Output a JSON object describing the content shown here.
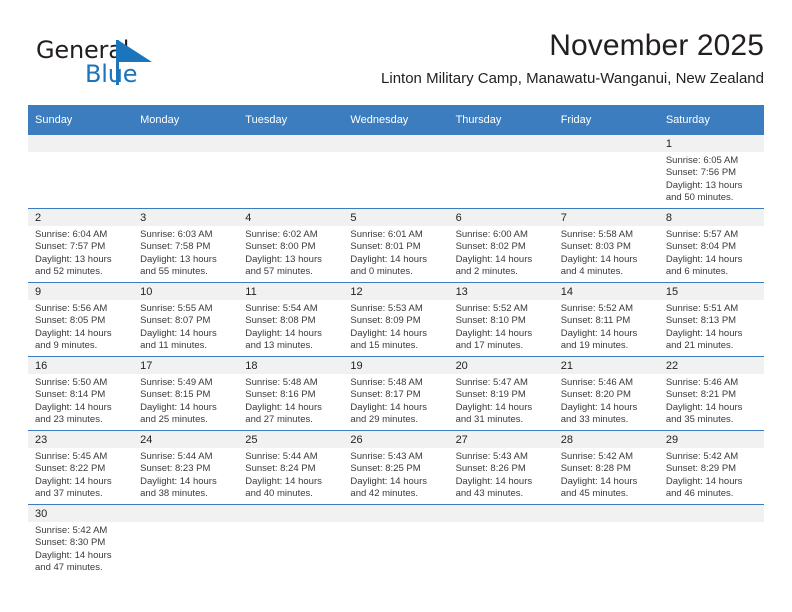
{
  "logo": {
    "word_one": "General",
    "word_two": "Blue",
    "icon": "triangle-flag-logo"
  },
  "header": {
    "month_title": "November 2025",
    "location": "Linton Military Camp, Manawatu-Wanganui, New Zealand"
  },
  "colors": {
    "header_blue": "#3c7dbf",
    "daynum_band": "#f1f1f1",
    "logo_blue": "#1b75bc",
    "text": "#231f20"
  },
  "calendar": {
    "columns": [
      "Sunday",
      "Monday",
      "Tuesday",
      "Wednesday",
      "Thursday",
      "Friday",
      "Saturday"
    ],
    "weeks": [
      [
        {
          "day": "",
          "sunrise": "",
          "sunset": "",
          "daylight_line1": "",
          "daylight_line2": ""
        },
        {
          "day": "",
          "sunrise": "",
          "sunset": "",
          "daylight_line1": "",
          "daylight_line2": ""
        },
        {
          "day": "",
          "sunrise": "",
          "sunset": "",
          "daylight_line1": "",
          "daylight_line2": ""
        },
        {
          "day": "",
          "sunrise": "",
          "sunset": "",
          "daylight_line1": "",
          "daylight_line2": ""
        },
        {
          "day": "",
          "sunrise": "",
          "sunset": "",
          "daylight_line1": "",
          "daylight_line2": ""
        },
        {
          "day": "",
          "sunrise": "",
          "sunset": "",
          "daylight_line1": "",
          "daylight_line2": ""
        },
        {
          "day": "1",
          "sunrise": "Sunrise: 6:05 AM",
          "sunset": "Sunset: 7:56 PM",
          "daylight_line1": "Daylight: 13 hours",
          "daylight_line2": "and 50 minutes."
        }
      ],
      [
        {
          "day": "2",
          "sunrise": "Sunrise: 6:04 AM",
          "sunset": "Sunset: 7:57 PM",
          "daylight_line1": "Daylight: 13 hours",
          "daylight_line2": "and 52 minutes."
        },
        {
          "day": "3",
          "sunrise": "Sunrise: 6:03 AM",
          "sunset": "Sunset: 7:58 PM",
          "daylight_line1": "Daylight: 13 hours",
          "daylight_line2": "and 55 minutes."
        },
        {
          "day": "4",
          "sunrise": "Sunrise: 6:02 AM",
          "sunset": "Sunset: 8:00 PM",
          "daylight_line1": "Daylight: 13 hours",
          "daylight_line2": "and 57 minutes."
        },
        {
          "day": "5",
          "sunrise": "Sunrise: 6:01 AM",
          "sunset": "Sunset: 8:01 PM",
          "daylight_line1": "Daylight: 14 hours",
          "daylight_line2": "and 0 minutes."
        },
        {
          "day": "6",
          "sunrise": "Sunrise: 6:00 AM",
          "sunset": "Sunset: 8:02 PM",
          "daylight_line1": "Daylight: 14 hours",
          "daylight_line2": "and 2 minutes."
        },
        {
          "day": "7",
          "sunrise": "Sunrise: 5:58 AM",
          "sunset": "Sunset: 8:03 PM",
          "daylight_line1": "Daylight: 14 hours",
          "daylight_line2": "and 4 minutes."
        },
        {
          "day": "8",
          "sunrise": "Sunrise: 5:57 AM",
          "sunset": "Sunset: 8:04 PM",
          "daylight_line1": "Daylight: 14 hours",
          "daylight_line2": "and 6 minutes."
        }
      ],
      [
        {
          "day": "9",
          "sunrise": "Sunrise: 5:56 AM",
          "sunset": "Sunset: 8:05 PM",
          "daylight_line1": "Daylight: 14 hours",
          "daylight_line2": "and 9 minutes."
        },
        {
          "day": "10",
          "sunrise": "Sunrise: 5:55 AM",
          "sunset": "Sunset: 8:07 PM",
          "daylight_line1": "Daylight: 14 hours",
          "daylight_line2": "and 11 minutes."
        },
        {
          "day": "11",
          "sunrise": "Sunrise: 5:54 AM",
          "sunset": "Sunset: 8:08 PM",
          "daylight_line1": "Daylight: 14 hours",
          "daylight_line2": "and 13 minutes."
        },
        {
          "day": "12",
          "sunrise": "Sunrise: 5:53 AM",
          "sunset": "Sunset: 8:09 PM",
          "daylight_line1": "Daylight: 14 hours",
          "daylight_line2": "and 15 minutes."
        },
        {
          "day": "13",
          "sunrise": "Sunrise: 5:52 AM",
          "sunset": "Sunset: 8:10 PM",
          "daylight_line1": "Daylight: 14 hours",
          "daylight_line2": "and 17 minutes."
        },
        {
          "day": "14",
          "sunrise": "Sunrise: 5:52 AM",
          "sunset": "Sunset: 8:11 PM",
          "daylight_line1": "Daylight: 14 hours",
          "daylight_line2": "and 19 minutes."
        },
        {
          "day": "15",
          "sunrise": "Sunrise: 5:51 AM",
          "sunset": "Sunset: 8:13 PM",
          "daylight_line1": "Daylight: 14 hours",
          "daylight_line2": "and 21 minutes."
        }
      ],
      [
        {
          "day": "16",
          "sunrise": "Sunrise: 5:50 AM",
          "sunset": "Sunset: 8:14 PM",
          "daylight_line1": "Daylight: 14 hours",
          "daylight_line2": "and 23 minutes."
        },
        {
          "day": "17",
          "sunrise": "Sunrise: 5:49 AM",
          "sunset": "Sunset: 8:15 PM",
          "daylight_line1": "Daylight: 14 hours",
          "daylight_line2": "and 25 minutes."
        },
        {
          "day": "18",
          "sunrise": "Sunrise: 5:48 AM",
          "sunset": "Sunset: 8:16 PM",
          "daylight_line1": "Daylight: 14 hours",
          "daylight_line2": "and 27 minutes."
        },
        {
          "day": "19",
          "sunrise": "Sunrise: 5:48 AM",
          "sunset": "Sunset: 8:17 PM",
          "daylight_line1": "Daylight: 14 hours",
          "daylight_line2": "and 29 minutes."
        },
        {
          "day": "20",
          "sunrise": "Sunrise: 5:47 AM",
          "sunset": "Sunset: 8:19 PM",
          "daylight_line1": "Daylight: 14 hours",
          "daylight_line2": "and 31 minutes."
        },
        {
          "day": "21",
          "sunrise": "Sunrise: 5:46 AM",
          "sunset": "Sunset: 8:20 PM",
          "daylight_line1": "Daylight: 14 hours",
          "daylight_line2": "and 33 minutes."
        },
        {
          "day": "22",
          "sunrise": "Sunrise: 5:46 AM",
          "sunset": "Sunset: 8:21 PM",
          "daylight_line1": "Daylight: 14 hours",
          "daylight_line2": "and 35 minutes."
        }
      ],
      [
        {
          "day": "23",
          "sunrise": "Sunrise: 5:45 AM",
          "sunset": "Sunset: 8:22 PM",
          "daylight_line1": "Daylight: 14 hours",
          "daylight_line2": "and 37 minutes."
        },
        {
          "day": "24",
          "sunrise": "Sunrise: 5:44 AM",
          "sunset": "Sunset: 8:23 PM",
          "daylight_line1": "Daylight: 14 hours",
          "daylight_line2": "and 38 minutes."
        },
        {
          "day": "25",
          "sunrise": "Sunrise: 5:44 AM",
          "sunset": "Sunset: 8:24 PM",
          "daylight_line1": "Daylight: 14 hours",
          "daylight_line2": "and 40 minutes."
        },
        {
          "day": "26",
          "sunrise": "Sunrise: 5:43 AM",
          "sunset": "Sunset: 8:25 PM",
          "daylight_line1": "Daylight: 14 hours",
          "daylight_line2": "and 42 minutes."
        },
        {
          "day": "27",
          "sunrise": "Sunrise: 5:43 AM",
          "sunset": "Sunset: 8:26 PM",
          "daylight_line1": "Daylight: 14 hours",
          "daylight_line2": "and 43 minutes."
        },
        {
          "day": "28",
          "sunrise": "Sunrise: 5:42 AM",
          "sunset": "Sunset: 8:28 PM",
          "daylight_line1": "Daylight: 14 hours",
          "daylight_line2": "and 45 minutes."
        },
        {
          "day": "29",
          "sunrise": "Sunrise: 5:42 AM",
          "sunset": "Sunset: 8:29 PM",
          "daylight_line1": "Daylight: 14 hours",
          "daylight_line2": "and 46 minutes."
        }
      ],
      [
        {
          "day": "30",
          "sunrise": "Sunrise: 5:42 AM",
          "sunset": "Sunset: 8:30 PM",
          "daylight_line1": "Daylight: 14 hours",
          "daylight_line2": "and 47 minutes."
        },
        {
          "day": "",
          "sunrise": "",
          "sunset": "",
          "daylight_line1": "",
          "daylight_line2": ""
        },
        {
          "day": "",
          "sunrise": "",
          "sunset": "",
          "daylight_line1": "",
          "daylight_line2": ""
        },
        {
          "day": "",
          "sunrise": "",
          "sunset": "",
          "daylight_line1": "",
          "daylight_line2": ""
        },
        {
          "day": "",
          "sunrise": "",
          "sunset": "",
          "daylight_line1": "",
          "daylight_line2": ""
        },
        {
          "day": "",
          "sunrise": "",
          "sunset": "",
          "daylight_line1": "",
          "daylight_line2": ""
        },
        {
          "day": "",
          "sunrise": "",
          "sunset": "",
          "daylight_line1": "",
          "daylight_line2": ""
        }
      ]
    ]
  }
}
